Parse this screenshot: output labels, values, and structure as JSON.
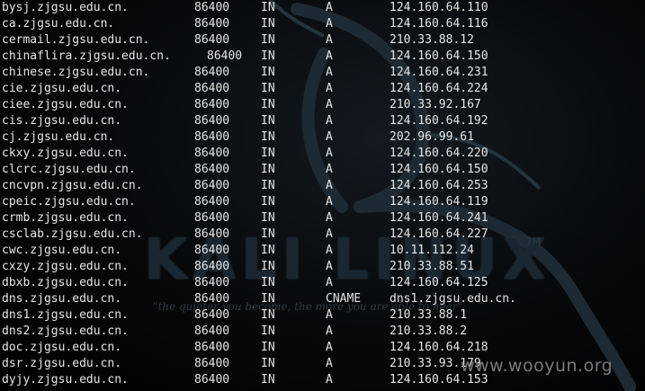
{
  "watermark": "www.wooyun.org",
  "background_logo": {
    "wordmark": "KALI LINUX",
    "trademark": "TM",
    "motto": "\"the quieter you become, the more you are able to hear\""
  },
  "records": [
    {
      "name": "bysj.zjgsu.edu.cn.",
      "ttl": "86400",
      "class": "IN",
      "type": "A",
      "value": "124.160.64.110"
    },
    {
      "name": "ca.zjgsu.edu.cn.",
      "ttl": "86400",
      "class": "IN",
      "type": "A",
      "value": "124.160.64.116"
    },
    {
      "name": "cermail.zjgsu.edu.cn.",
      "ttl": "86400",
      "class": "IN",
      "type": "A",
      "value": "210.33.88.12"
    },
    {
      "name": "chinaflira.zjgsu.edu.cn.",
      "ttl": "86400",
      "class": "IN",
      "type": "A",
      "value": "124.160.64.150"
    },
    {
      "name": "chinese.zjgsu.edu.cn.",
      "ttl": "86400",
      "class": "IN",
      "type": "A",
      "value": "124.160.64.231"
    },
    {
      "name": "cie.zjgsu.edu.cn.",
      "ttl": "86400",
      "class": "IN",
      "type": "A",
      "value": "124.160.64.224"
    },
    {
      "name": "ciee.zjgsu.edu.cn.",
      "ttl": "86400",
      "class": "IN",
      "type": "A",
      "value": "210.33.92.167"
    },
    {
      "name": "cis.zjgsu.edu.cn.",
      "ttl": "86400",
      "class": "IN",
      "type": "A",
      "value": "124.160.64.192"
    },
    {
      "name": "cj.zjgsu.edu.cn.",
      "ttl": "86400",
      "class": "IN",
      "type": "A",
      "value": "202.96.99.61"
    },
    {
      "name": "ckxy.zjgsu.edu.cn.",
      "ttl": "86400",
      "class": "IN",
      "type": "A",
      "value": "124.160.64.220"
    },
    {
      "name": "clcrc.zjgsu.edu.cn.",
      "ttl": "86400",
      "class": "IN",
      "type": "A",
      "value": "124.160.64.150"
    },
    {
      "name": "cncvpn.zjgsu.edu.cn.",
      "ttl": "86400",
      "class": "IN",
      "type": "A",
      "value": "124.160.64.253"
    },
    {
      "name": "cpeic.zjgsu.edu.cn.",
      "ttl": "86400",
      "class": "IN",
      "type": "A",
      "value": "124.160.64.119"
    },
    {
      "name": "crmb.zjgsu.edu.cn.",
      "ttl": "86400",
      "class": "IN",
      "type": "A",
      "value": "124.160.64.241"
    },
    {
      "name": "csclab.zjgsu.edu.cn.",
      "ttl": "86400",
      "class": "IN",
      "type": "A",
      "value": "124.160.64.227"
    },
    {
      "name": "cwc.zjgsu.edu.cn.",
      "ttl": "86400",
      "class": "IN",
      "type": "A",
      "value": "10.11.112.24"
    },
    {
      "name": "cxzy.zjgsu.edu.cn.",
      "ttl": "86400",
      "class": "IN",
      "type": "A",
      "value": "210.33.88.51"
    },
    {
      "name": "dbxb.zjgsu.edu.cn.",
      "ttl": "86400",
      "class": "IN",
      "type": "A",
      "value": "124.160.64.125"
    },
    {
      "name": "dns.zjgsu.edu.cn.",
      "ttl": "86400",
      "class": "IN",
      "type": "CNAME",
      "value": "dns1.zjgsu.edu.cn."
    },
    {
      "name": "dns1.zjgsu.edu.cn.",
      "ttl": "86400",
      "class": "IN",
      "type": "A",
      "value": "210.33.88.1"
    },
    {
      "name": "dns2.zjgsu.edu.cn.",
      "ttl": "86400",
      "class": "IN",
      "type": "A",
      "value": "210.33.88.2"
    },
    {
      "name": "doc.zjgsu.edu.cn.",
      "ttl": "86400",
      "class": "IN",
      "type": "A",
      "value": "124.160.64.218"
    },
    {
      "name": "dsr.zjgsu.edu.cn.",
      "ttl": "86400",
      "class": "IN",
      "type": "A",
      "value": "210.33.93.179"
    },
    {
      "name": "dyjy.zjgsu.edu.cn.",
      "ttl": "86400",
      "class": "IN",
      "type": "A",
      "value": "124.160.64.153"
    }
  ]
}
